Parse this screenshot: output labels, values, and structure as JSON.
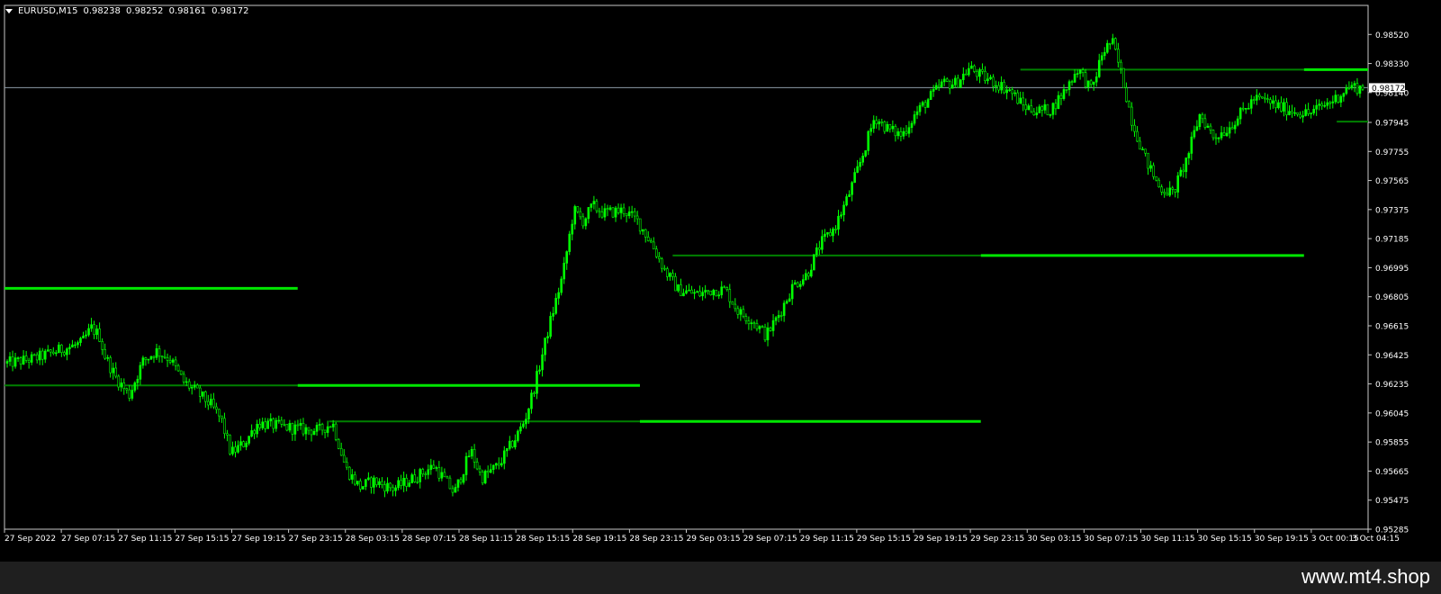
{
  "header": {
    "symbol": "EURUSD,M15",
    "open": "0.98238",
    "high": "0.98252",
    "low": "0.98161",
    "close": "0.98172"
  },
  "watermark": "www.mt4.shop",
  "colors": {
    "background": "#000000",
    "candle": "#00ff00",
    "level_dark": "#008000",
    "level_bright": "#00e600",
    "price_line": "#8c9aa6",
    "axis_text": "#ffffff"
  },
  "chart_data": {
    "type": "candlestick",
    "ylim": [
      0.95285,
      0.9871
    ],
    "y_ticks": [
      "0.98520",
      "0.98330",
      "0.98140",
      "0.97945",
      "0.97755",
      "0.97565",
      "0.97375",
      "0.97185",
      "0.96995",
      "0.96805",
      "0.96615",
      "0.96425",
      "0.96235",
      "0.96045",
      "0.95855",
      "0.95665",
      "0.95475",
      "0.95285"
    ],
    "x_labels": [
      "27 Sep 2022",
      "27 Sep 07:15",
      "27 Sep 11:15",
      "27 Sep 15:15",
      "27 Sep 19:15",
      "27 Sep 23:15",
      "28 Sep 03:15",
      "28 Sep 07:15",
      "28 Sep 11:15",
      "28 Sep 15:15",
      "28 Sep 19:15",
      "28 Sep 23:15",
      "29 Sep 03:15",
      "29 Sep 07:15",
      "29 Sep 11:15",
      "29 Sep 15:15",
      "29 Sep 19:15",
      "29 Sep 23:15",
      "30 Sep 03:15",
      "30 Sep 07:15",
      "30 Sep 11:15",
      "30 Sep 15:15",
      "30 Sep 19:15",
      "3 Oct 00:15",
      "3 Oct 04:15"
    ],
    "current_price": "0.98172",
    "current_price_value": 0.98172,
    "levels": [
      {
        "value": 0.9686,
        "from": 0.0,
        "to": 0.215,
        "style": "bright"
      },
      {
        "value": 0.96225,
        "from": 0.0,
        "to": 0.215,
        "style": "dark"
      },
      {
        "value": 0.96225,
        "from": 0.215,
        "to": 0.466,
        "style": "bright"
      },
      {
        "value": 0.9599,
        "from": 0.238,
        "to": 0.466,
        "style": "dark"
      },
      {
        "value": 0.9599,
        "from": 0.466,
        "to": 0.716,
        "style": "bright"
      },
      {
        "value": 0.97075,
        "from": 0.49,
        "to": 0.716,
        "style": "dark"
      },
      {
        "value": 0.97075,
        "from": 0.716,
        "to": 0.953,
        "style": "bright"
      },
      {
        "value": 0.9829,
        "from": 0.745,
        "to": 0.953,
        "style": "dark"
      },
      {
        "value": 0.9829,
        "from": 0.953,
        "to": 1.0,
        "style": "bright"
      },
      {
        "value": 0.9795,
        "from": 0.977,
        "to": 1.0,
        "style": "dark"
      }
    ],
    "path": [
      [
        0.0,
        0.9637
      ],
      [
        0.02,
        0.964
      ],
      [
        0.04,
        0.9646
      ],
      [
        0.055,
        0.965
      ],
      [
        0.062,
        0.966
      ],
      [
        0.068,
        0.9655
      ],
      [
        0.072,
        0.9642
      ],
      [
        0.08,
        0.9628
      ],
      [
        0.09,
        0.9616
      ],
      [
        0.1,
        0.9638
      ],
      [
        0.11,
        0.9645
      ],
      [
        0.12,
        0.964
      ],
      [
        0.13,
        0.9625
      ],
      [
        0.14,
        0.9618
      ],
      [
        0.15,
        0.961
      ],
      [
        0.158,
        0.96
      ],
      [
        0.165,
        0.9578
      ],
      [
        0.175,
        0.9585
      ],
      [
        0.185,
        0.9598
      ],
      [
        0.2,
        0.9596
      ],
      [
        0.215,
        0.9594
      ],
      [
        0.23,
        0.9593
      ],
      [
        0.24,
        0.9598
      ],
      [
        0.25,
        0.9568
      ],
      [
        0.26,
        0.9556
      ],
      [
        0.27,
        0.956
      ],
      [
        0.285,
        0.9555
      ],
      [
        0.3,
        0.9562
      ],
      [
        0.315,
        0.957
      ],
      [
        0.33,
        0.9552
      ],
      [
        0.342,
        0.958
      ],
      [
        0.35,
        0.9562
      ],
      [
        0.362,
        0.957
      ],
      [
        0.375,
        0.9588
      ],
      [
        0.382,
        0.96
      ],
      [
        0.39,
        0.9625
      ],
      [
        0.4,
        0.9662
      ],
      [
        0.41,
        0.9695
      ],
      [
        0.418,
        0.9737
      ],
      [
        0.425,
        0.973
      ],
      [
        0.432,
        0.974
      ],
      [
        0.44,
        0.9735
      ],
      [
        0.455,
        0.9737
      ],
      [
        0.465,
        0.973
      ],
      [
        0.475,
        0.9716
      ],
      [
        0.485,
        0.9698
      ],
      [
        0.495,
        0.9685
      ],
      [
        0.51,
        0.9682
      ],
      [
        0.52,
        0.9685
      ],
      [
        0.53,
        0.9685
      ],
      [
        0.54,
        0.967
      ],
      [
        0.55,
        0.9665
      ],
      [
        0.56,
        0.9655
      ],
      [
        0.57,
        0.967
      ],
      [
        0.58,
        0.9688
      ],
      [
        0.59,
        0.9695
      ],
      [
        0.6,
        0.9715
      ],
      [
        0.61,
        0.9725
      ],
      [
        0.62,
        0.9745
      ],
      [
        0.63,
        0.977
      ],
      [
        0.64,
        0.9798
      ],
      [
        0.65,
        0.979
      ],
      [
        0.66,
        0.9786
      ],
      [
        0.67,
        0.98
      ],
      [
        0.68,
        0.981
      ],
      [
        0.69,
        0.982
      ],
      [
        0.7,
        0.982
      ],
      [
        0.71,
        0.983
      ],
      [
        0.72,
        0.9824
      ],
      [
        0.73,
        0.982
      ],
      [
        0.74,
        0.9815
      ],
      [
        0.75,
        0.9805
      ],
      [
        0.76,
        0.9802
      ],
      [
        0.77,
        0.9803
      ],
      [
        0.78,
        0.9815
      ],
      [
        0.79,
        0.983
      ],
      [
        0.8,
        0.9815
      ],
      [
        0.808,
        0.984
      ],
      [
        0.815,
        0.9848
      ],
      [
        0.822,
        0.9826
      ],
      [
        0.83,
        0.9795
      ],
      [
        0.84,
        0.977
      ],
      [
        0.85,
        0.9752
      ],
      [
        0.86,
        0.9748
      ],
      [
        0.87,
        0.977
      ],
      [
        0.88,
        0.98
      ],
      [
        0.89,
        0.9785
      ],
      [
        0.9,
        0.979
      ],
      [
        0.91,
        0.98
      ],
      [
        0.92,
        0.981
      ],
      [
        0.93,
        0.9808
      ],
      [
        0.94,
        0.9804
      ],
      [
        0.95,
        0.9802
      ],
      [
        0.96,
        0.98
      ],
      [
        0.97,
        0.9805
      ],
      [
        0.98,
        0.981
      ],
      [
        0.99,
        0.9818
      ],
      [
        1.0,
        0.9817
      ]
    ]
  }
}
